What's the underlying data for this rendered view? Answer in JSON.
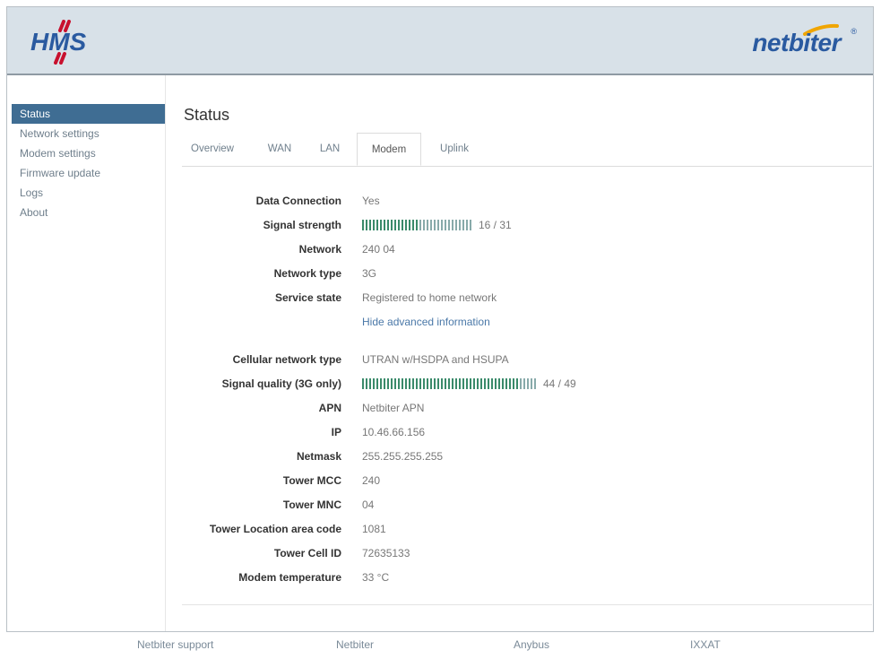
{
  "header": {
    "left_logo_text": "HMS",
    "right_logo_text": "netbiter",
    "registered_mark": "®"
  },
  "sidebar": {
    "items": [
      {
        "label": "Status",
        "active": true
      },
      {
        "label": "Network settings",
        "active": false
      },
      {
        "label": "Modem settings",
        "active": false
      },
      {
        "label": "Firmware update",
        "active": false
      },
      {
        "label": "Logs",
        "active": false
      },
      {
        "label": "About",
        "active": false
      }
    ]
  },
  "main": {
    "title": "Status",
    "tabs": [
      {
        "label": "Overview",
        "active": false
      },
      {
        "label": "WAN",
        "active": false
      },
      {
        "label": "LAN",
        "active": false
      },
      {
        "label": "Modem",
        "active": true
      },
      {
        "label": "Uplink",
        "active": false
      }
    ],
    "fields": {
      "data_connection": {
        "label": "Data Connection",
        "value": "Yes"
      },
      "signal_strength": {
        "label": "Signal strength",
        "value": 16,
        "max": 31,
        "text": "16 / 31"
      },
      "network": {
        "label": "Network",
        "value": "240 04"
      },
      "network_type": {
        "label": "Network type",
        "value": "3G"
      },
      "service_state": {
        "label": "Service state",
        "value": "Registered to home network"
      },
      "advanced_link": "Hide advanced information",
      "cellular_network_type": {
        "label": "Cellular network type",
        "value": "UTRAN w/HSDPA and HSUPA"
      },
      "signal_quality": {
        "label": "Signal quality (3G only)",
        "value": 44,
        "max": 49,
        "text": "44 / 49"
      },
      "apn": {
        "label": "APN",
        "value": "Netbiter APN"
      },
      "ip": {
        "label": "IP",
        "value": "10.46.66.156"
      },
      "netmask": {
        "label": "Netmask",
        "value": "255.255.255.255"
      },
      "tower_mcc": {
        "label": "Tower MCC",
        "value": "240"
      },
      "tower_mnc": {
        "label": "Tower MNC",
        "value": "04"
      },
      "tower_lac": {
        "label": "Tower Location area code",
        "value": "1081"
      },
      "tower_cell_id": {
        "label": "Tower Cell ID",
        "value": "72635133"
      },
      "modem_temperature": {
        "label": "Modem temperature",
        "value": "33 °C"
      }
    }
  },
  "footer": {
    "links": [
      "Netbiter support",
      "Netbiter",
      "Anybus",
      "IXXAT"
    ]
  },
  "colors": {
    "header_bg": "#d8e1e8",
    "active_nav": "#3f6d93",
    "signal_bar": "#3a8a6a",
    "link": "#4a78a8",
    "hms_red": "#c8102e",
    "hms_blue": "#2a5aa0"
  }
}
